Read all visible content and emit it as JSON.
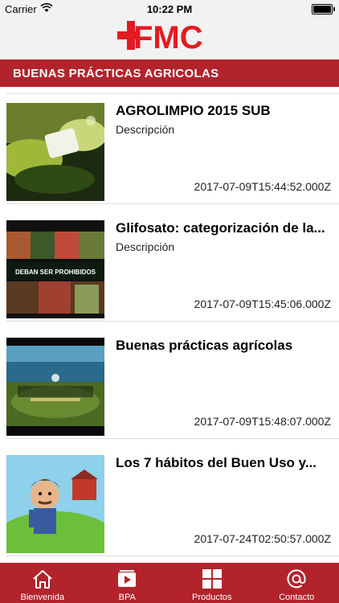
{
  "status_bar": {
    "carrier": "Carrier",
    "time": "10:22 PM"
  },
  "header": {
    "logo_text": "FMC",
    "brand_color": "#e31b23"
  },
  "title_bar": {
    "title": "BUENAS PRÁCTICAS AGRICOLAS",
    "color": "#b3232b"
  },
  "list": {
    "items": [
      {
        "title": "AGROLIMPIO 2015 SUB",
        "description": "Descripción",
        "date": "2017-07-09T15:44:52.000Z"
      },
      {
        "title": "Glifosato: categorización de la...",
        "description": "Descripción",
        "date": "2017-07-09T15:45:06.000Z",
        "thumb_text_line1": "DEBAN SER PROHIBIDOS"
      },
      {
        "title": "Buenas prácticas agrícolas",
        "description": "",
        "date": "2017-07-09T15:48:07.000Z"
      },
      {
        "title": "Los 7 hábitos del Buen Uso y...",
        "description": "",
        "date": "2017-07-24T02:50:57.000Z"
      }
    ]
  },
  "tab_bar": {
    "tabs": [
      {
        "label": "Bienvenida",
        "icon": "home-icon"
      },
      {
        "label": "BPA",
        "icon": "video-icon"
      },
      {
        "label": "Productos",
        "icon": "grid-icon"
      },
      {
        "label": "Contacto",
        "icon": "at-icon"
      }
    ]
  }
}
